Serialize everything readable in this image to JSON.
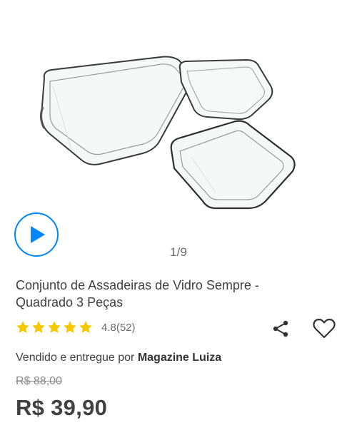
{
  "gallery": {
    "page_indicator": "1/9",
    "play_icon": "play-icon",
    "accent_color": "#0086ff"
  },
  "product": {
    "title": "Conjunto de Assadeiras de Vidro Sempre - Quadrado 3 Peças",
    "rating": {
      "stars": 5,
      "value": 4.8,
      "count": 52,
      "text": "4.8(52)",
      "star_color": "#f5c800"
    },
    "actions": {
      "share_icon": "share-icon",
      "favorite_icon": "heart-icon"
    },
    "seller": {
      "prefix": "Vendido e entregue por",
      "name": "Magazine Luiza"
    },
    "old_price": "R$ 88,00",
    "price": "R$ 39,90"
  }
}
